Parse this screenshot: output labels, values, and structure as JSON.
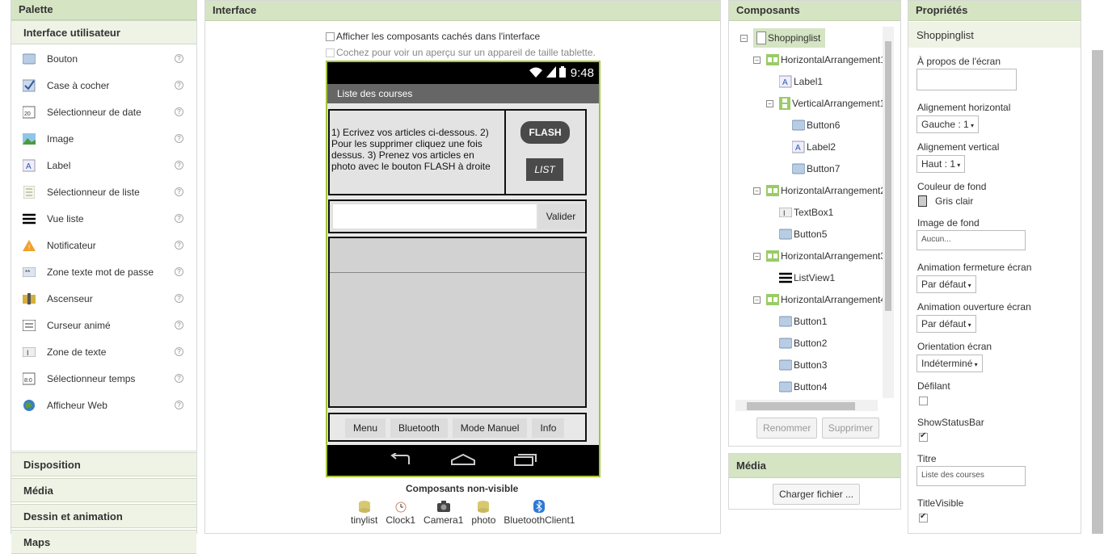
{
  "palette": {
    "title": "Palette",
    "section": "Interface utilisateur",
    "items": [
      {
        "label": "Bouton",
        "icon": "button-icon"
      },
      {
        "label": "Case à cocher",
        "icon": "checkbox-icon"
      },
      {
        "label": "Sélectionneur de date",
        "icon": "date-picker-icon"
      },
      {
        "label": "Image",
        "icon": "image-icon"
      },
      {
        "label": "Label",
        "icon": "label-icon"
      },
      {
        "label": "Sélectionneur de liste",
        "icon": "list-picker-icon"
      },
      {
        "label": "Vue liste",
        "icon": "list-view-icon"
      },
      {
        "label": "Notificateur",
        "icon": "notifier-icon"
      },
      {
        "label": "Zone texte mot de passe",
        "icon": "password-icon"
      },
      {
        "label": "Ascenseur",
        "icon": "slider-icon"
      },
      {
        "label": "Curseur animé",
        "icon": "spinner-icon"
      },
      {
        "label": "Zone de texte",
        "icon": "textbox-icon"
      },
      {
        "label": "Sélectionneur temps",
        "icon": "time-picker-icon"
      },
      {
        "label": "Afficheur Web",
        "icon": "web-viewer-icon"
      }
    ],
    "help": "?",
    "categories": [
      "Disposition",
      "Média",
      "Dessin et animation",
      "Maps"
    ]
  },
  "interface": {
    "title": "Interface",
    "show_hidden": "Afficher les composants cachés dans l'interface",
    "tablet": "Cochez pour voir un aperçu sur un appareil de taille tablette.",
    "phone": {
      "time": "9:48",
      "title": "Liste des courses",
      "instructions": "1) Ecrivez vos articles ci-dessous. 2) Pour les supprimer cliquez une fois dessus. 3) Prenez vos articles en photo avec le bouton FLASH à droite",
      "flash": "FLASH",
      "list": "LIST",
      "validate": "Valider",
      "menu": [
        "Menu",
        "Bluetooth",
        "Mode Manuel",
        "Info"
      ]
    },
    "nonvisible_title": "Composants non-visible",
    "nonvisible": [
      {
        "label": "tinylist",
        "icon": "database-icon"
      },
      {
        "label": "Clock1",
        "icon": "clock-icon"
      },
      {
        "label": "Camera1",
        "icon": "camera-icon"
      },
      {
        "label": "photo",
        "icon": "database-icon"
      },
      {
        "label": "BluetoothClient1",
        "icon": "bluetooth-icon"
      }
    ]
  },
  "components": {
    "title": "Composants",
    "tree": [
      "Shoppinglist",
      "HorizontalArrangement1",
      "Label1",
      "VerticalArrangement1",
      "Button6",
      "Label2",
      "Button7",
      "HorizontalArrangement2",
      "TextBox1",
      "Button5",
      "HorizontalArrangement3",
      "ListView1",
      "HorizontalArrangement4",
      "Button1",
      "Button2",
      "Button3",
      "Button4"
    ],
    "rename": "Renommer",
    "delete": "Supprimer"
  },
  "media": {
    "title": "Média",
    "upload": "Charger fichier ..."
  },
  "properties": {
    "title": "Propriétés",
    "component": "Shoppinglist",
    "about_label": "À propos de l'écran",
    "halign_label": "Alignement horizontal",
    "halign": "Gauche : 1",
    "valign_label": "Alignement vertical",
    "valign": "Haut : 1",
    "bg_label": "Couleur de fond",
    "bg": "Gris clair",
    "bg_color": "#cccccc",
    "img_label": "Image de fond",
    "img": "Aucun...",
    "close_anim_label": "Animation fermeture écran",
    "close_anim": "Par défaut",
    "open_anim_label": "Animation ouverture écran",
    "open_anim": "Par défaut",
    "orient_label": "Orientation écran",
    "orient": "Indéterminé",
    "scroll_label": "Défilant",
    "status_label": "ShowStatusBar",
    "title_label": "Titre",
    "title_val": "Liste des courses",
    "title_vis_label": "TitleVisible"
  }
}
